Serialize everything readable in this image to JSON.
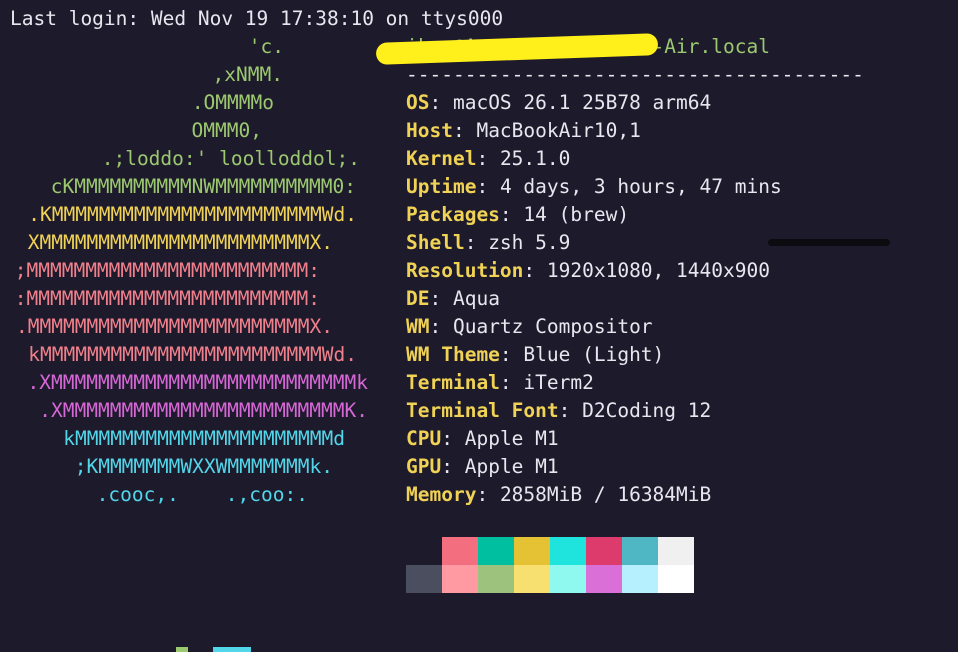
{
  "terminal": {
    "login_line": "Last login: Wed Nov 19 17:38:10 on ttys000"
  },
  "logo": {
    "lines": [
      {
        "text": "'c.",
        "color": "#9cc870"
      },
      {
        "text": ",xNMM.",
        "color": "#9cc870"
      },
      {
        "text": ".OMMMMo",
        "color": "#9cc870"
      },
      {
        "text": "OMMM0,",
        "color": "#9cc870"
      },
      {
        "text": ".;loddo:' loolloddol;.",
        "color": "#9cc870"
      },
      {
        "text": "cKMMMMMMMMMMNWMMMMMMMMMM0:",
        "color": "#9cc870"
      },
      {
        "text": ".KMMMMMMMMMMMMMMMMMMMMMMMWd.",
        "color": "#f0d255"
      },
      {
        "text": "XMMMMMMMMMMMMMMMMMMMMMMMX.",
        "color": "#f0d255"
      },
      {
        "text": ";MMMMMMMMMMMMMMMMMMMMMMMM:",
        "color": "#f0808c"
      },
      {
        "text": ":MMMMMMMMMMMMMMMMMMMMMMMM:",
        "color": "#f0808c"
      },
      {
        "text": ".MMMMMMMMMMMMMMMMMMMMMMMMX.",
        "color": "#f0808c"
      },
      {
        "text": "kMMMMMMMMMMMMMMMMMMMMMMMMWd.",
        "color": "#f0808c"
      },
      {
        "text": ".XMMMMMMMMMMMMMMMMMMMMMMMMMMk",
        "color": "#d667d6"
      },
      {
        "text": ".XMMMMMMMMMMMMMMMMMMMMMMMMK.",
        "color": "#d667d6"
      },
      {
        "text": "kMMMMMMMMMMMMMMMMMMMMMMd",
        "color": "#52d6ea"
      },
      {
        "text": ";KMMMMMMMWXXWMMMMMMMk.",
        "color": "#52d6ea"
      },
      {
        "text": ".cooc,.    .,coo:.",
        "color": "#52d6ea"
      }
    ]
  },
  "info": {
    "host_title": "ikas@Asmnuris-MacBook-Air.local",
    "separator": "---------------------------------------",
    "rows": [
      {
        "key": "OS",
        "value": "macOS 26.1 25B78 arm64"
      },
      {
        "key": "Host",
        "value": "MacBookAir10,1"
      },
      {
        "key": "Kernel",
        "value": "25.1.0"
      },
      {
        "key": "Uptime",
        "value": "4 days, 3 hours, 47 mins"
      },
      {
        "key": "Packages",
        "value": "14 (brew)"
      },
      {
        "key": "Shell",
        "value": "zsh 5.9"
      },
      {
        "key": "Resolution",
        "value": "1920x1080, 1440x900"
      },
      {
        "key": "DE",
        "value": "Aqua"
      },
      {
        "key": "WM",
        "value": "Quartz Compositor"
      },
      {
        "key": "WM Theme",
        "value": "Blue (Light)"
      },
      {
        "key": "Terminal",
        "value": "iTerm2"
      },
      {
        "key": "Terminal Font",
        "value": "D2Coding 12"
      },
      {
        "key": "CPU",
        "value": "Apple M1"
      },
      {
        "key": "GPU",
        "value": "Apple M1"
      },
      {
        "key": "Memory",
        "value": "2858MiB / 16384MiB"
      }
    ]
  },
  "palette": {
    "row1": [
      "#1d1a2b",
      "#f36f7f",
      "#00bfa0",
      "#e5c234",
      "#1ee4dd",
      "#dd3b6b",
      "#4fb6c3",
      "#f0f0f0"
    ],
    "row2": [
      "#4a4e5f",
      "#ff9aa2",
      "#9cc27e",
      "#f8e070",
      "#8ff9ef",
      "#da6fd8",
      "#b6f0ff",
      "#ffffff"
    ]
  },
  "colors": {
    "background": "#1d1a2b",
    "key_color": "#f0d255",
    "highlighter": "#ffef1a",
    "marker": "#0b0b10"
  }
}
